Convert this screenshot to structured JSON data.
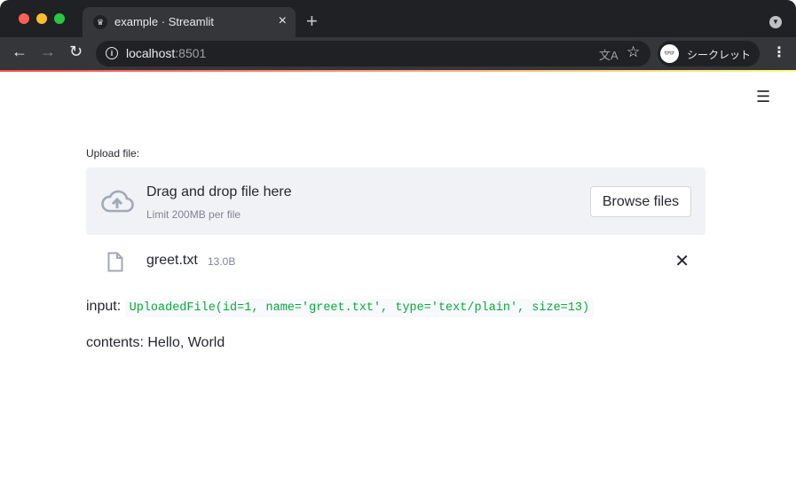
{
  "browser": {
    "tab_title": "example · Streamlit",
    "url_host": "localhost",
    "url_port": ":8501",
    "incognito_label": "シークレット"
  },
  "app": {
    "uploader_label": "Upload file:",
    "drop_title": "Drag and drop file here",
    "drop_limit": "Limit 200MB per file",
    "browse_label": "Browse files",
    "file_name": "greet.txt",
    "file_size": "13.0B",
    "input_label": "input:",
    "input_value": "UploadedFile(id=1, name='greet.txt', type='text/plain', size=13)",
    "contents_text": "contents: Hello, World"
  },
  "colors": {
    "accent": "#ff4b4b",
    "code": "#09ab3b",
    "dropzone": "#f0f2f6"
  }
}
